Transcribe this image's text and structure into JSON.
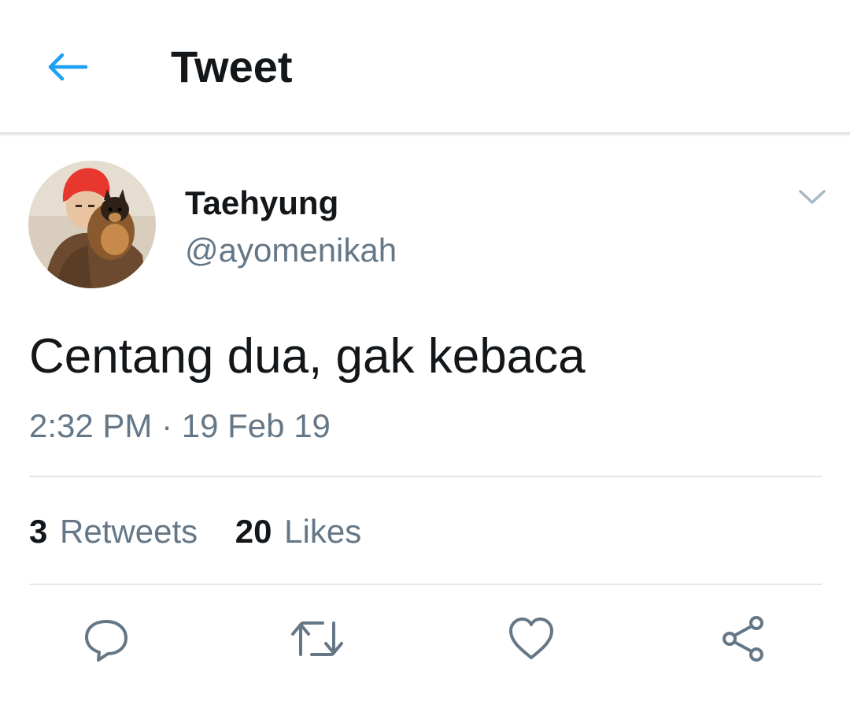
{
  "header": {
    "title": "Tweet",
    "back_icon": "arrow-left-icon"
  },
  "colors": {
    "accent": "#1da1f2",
    "text_primary": "#14171a",
    "text_secondary": "#657786",
    "divider": "#e1e8ed",
    "icon": "#657786"
  },
  "author": {
    "display_name": "Taehyung",
    "handle": "@ayomenikah",
    "menu_icon": "chevron-down-icon"
  },
  "tweet": {
    "text": "Centang dua, gak kebaca",
    "time": "2:32 PM",
    "separator": "·",
    "date": "19 Feb 19"
  },
  "stats": {
    "retweets_count": "3",
    "retweets_label": "Retweets",
    "likes_count": "20",
    "likes_label": "Likes"
  },
  "actions": [
    "reply-icon",
    "retweet-icon",
    "like-icon",
    "share-icon"
  ]
}
